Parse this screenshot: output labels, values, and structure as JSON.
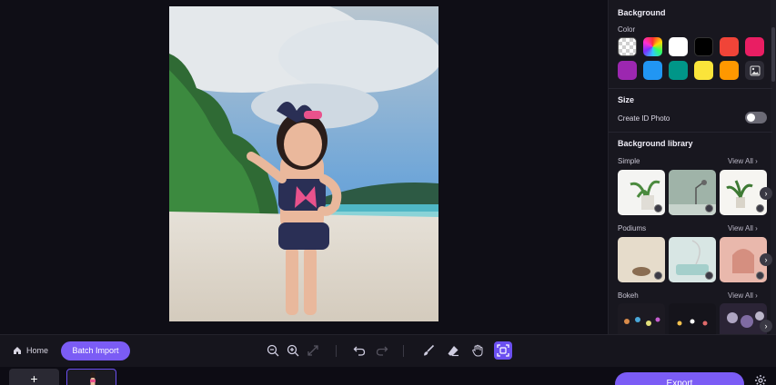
{
  "panel": {
    "background_title": "Background",
    "color_label": "Color",
    "swatches": [
      {
        "name": "transparent-swatch",
        "color": "transparent"
      },
      {
        "name": "rainbow-picker-swatch",
        "color": "rainbow"
      },
      {
        "name": "white-swatch",
        "color": "#ffffff"
      },
      {
        "name": "black-swatch",
        "color": "#000000"
      },
      {
        "name": "red-swatch",
        "color": "#f04438"
      },
      {
        "name": "pink-swatch",
        "color": "#e91e63"
      },
      {
        "name": "purple-swatch",
        "color": "#9c27b0"
      },
      {
        "name": "blue-swatch",
        "color": "#2196f3"
      },
      {
        "name": "teal-swatch",
        "color": "#009688"
      },
      {
        "name": "yellow-swatch",
        "color": "#fbe43a"
      },
      {
        "name": "orange-swatch",
        "color": "#ff9800"
      },
      {
        "name": "image-picker-swatch",
        "color": "image-icon"
      }
    ],
    "size_title": "Size",
    "id_photo_label": "Create ID Photo",
    "library_title": "Background library",
    "categories": [
      {
        "label": "Simple",
        "view_all": "View All"
      },
      {
        "label": "Podiums",
        "view_all": "View All"
      },
      {
        "label": "Bokeh",
        "view_all": "View All"
      }
    ]
  },
  "toolbar": {
    "home_label": "Home",
    "batch_label": "Batch Import",
    "icons": [
      "zoom-out-icon",
      "zoom-in-icon",
      "fit-screen-icon",
      "undo-icon",
      "redo-icon",
      "brush-icon",
      "eraser-icon",
      "hand-icon",
      "compare-icon"
    ]
  },
  "bottom": {
    "add_label": "+",
    "export_label": "Export"
  },
  "colors": {
    "accent": "#7b5cf5",
    "panel_bg": "#18171f",
    "canvas_bg": "#0f0e16"
  }
}
